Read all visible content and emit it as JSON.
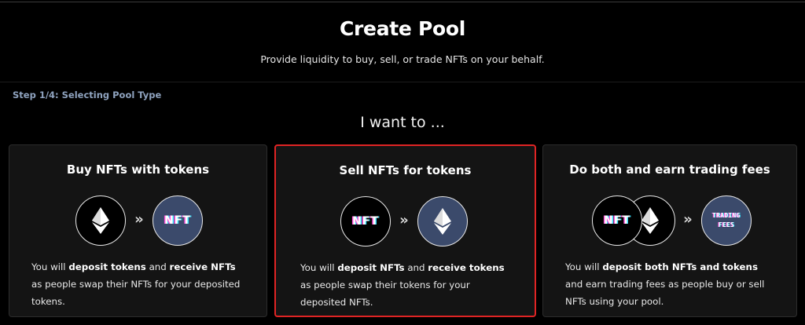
{
  "header": {
    "title": "Create Pool",
    "subtitle": "Provide liquidity to buy, sell, or trade NFTs on your behalf."
  },
  "step": "Step 1/4: Selecting Pool Type",
  "intro": "I want to ...",
  "cards": [
    {
      "title": "Buy NFTs with tokens",
      "desc": [
        {
          "text": "You will ",
          "bold": false
        },
        {
          "text": "deposit tokens",
          "bold": true
        },
        {
          "text": " and ",
          "bold": false
        },
        {
          "text": "receive NFTs",
          "bold": true
        },
        {
          "text": " as people swap their NFTs for your deposited tokens.",
          "bold": false
        }
      ],
      "selected": false
    },
    {
      "title": "Sell NFTs for tokens",
      "desc": [
        {
          "text": "You will ",
          "bold": false
        },
        {
          "text": "deposit NFTs",
          "bold": true
        },
        {
          "text": " and ",
          "bold": false
        },
        {
          "text": "receive tokens",
          "bold": true
        },
        {
          "text": " as people swap their tokens for your deposited NFTs.",
          "bold": false
        }
      ],
      "selected": true
    },
    {
      "title": "Do both and earn trading fees",
      "desc": [
        {
          "text": "You will ",
          "bold": false
        },
        {
          "text": "deposit both NFTs and tokens",
          "bold": true
        },
        {
          "text": " and earn trading fees as people buy or sell NFTs using your pool.",
          "bold": false
        }
      ],
      "selected": false
    }
  ],
  "icons": {
    "nft_label": "NFT",
    "trading_line1": "TRADING",
    "trading_line2": "FEES",
    "chevrons": "»"
  },
  "colors": {
    "background": "#000000",
    "card_background": "#141414",
    "selected_border": "#e02424",
    "step_text": "#8fa3bf",
    "token_circle": "#3b4a6b"
  }
}
